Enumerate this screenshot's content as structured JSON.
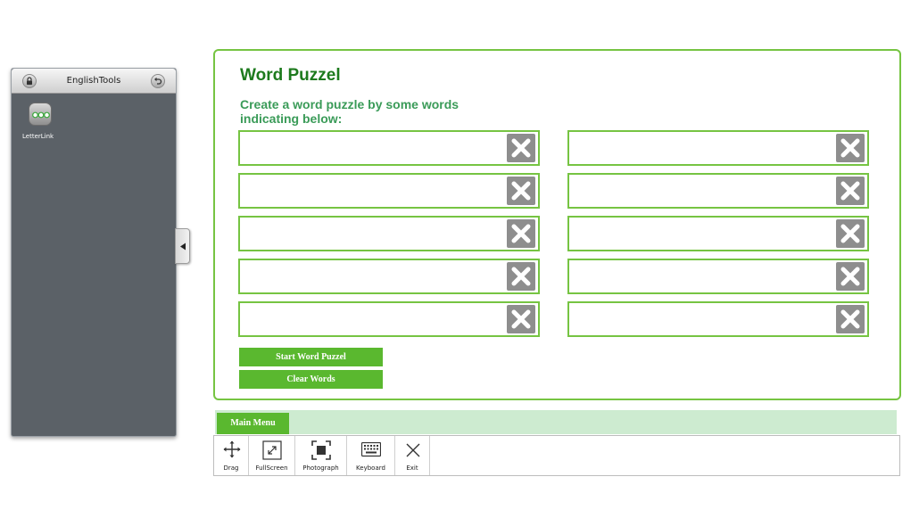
{
  "sidebar": {
    "title": "EnglishTools",
    "apps": [
      {
        "label": "LetterLink",
        "icon": "letterlink-icon"
      }
    ]
  },
  "panel": {
    "title": "Word Puzzel",
    "subtitle_line1": "Create a word puzzle by some words",
    "subtitle_line2": "indicating below:",
    "words": [
      {
        "value": ""
      },
      {
        "value": ""
      },
      {
        "value": ""
      },
      {
        "value": ""
      },
      {
        "value": ""
      },
      {
        "value": ""
      },
      {
        "value": ""
      },
      {
        "value": ""
      },
      {
        "value": ""
      },
      {
        "value": ""
      }
    ],
    "start_label": "Start Word Puzzel",
    "clear_label": "Clear Words"
  },
  "bottom": {
    "main_menu_label": "Main Menu",
    "tools": [
      {
        "label": "Drag",
        "icon": "move-icon"
      },
      {
        "label": "FullScreen",
        "icon": "fullscreen-icon"
      },
      {
        "label": "Photograph",
        "icon": "photograph-icon"
      },
      {
        "label": "Keyboard",
        "icon": "keyboard-icon"
      },
      {
        "label": "Exit",
        "icon": "close-icon"
      }
    ]
  },
  "colors": {
    "accent_green": "#5ab82f",
    "border_green": "#76c442",
    "title_green": "#1d7a1d",
    "subtitle_green": "#3a9b58",
    "sidebar_bg": "#5b6167",
    "menu_strip_bg": "#cdebd0"
  }
}
